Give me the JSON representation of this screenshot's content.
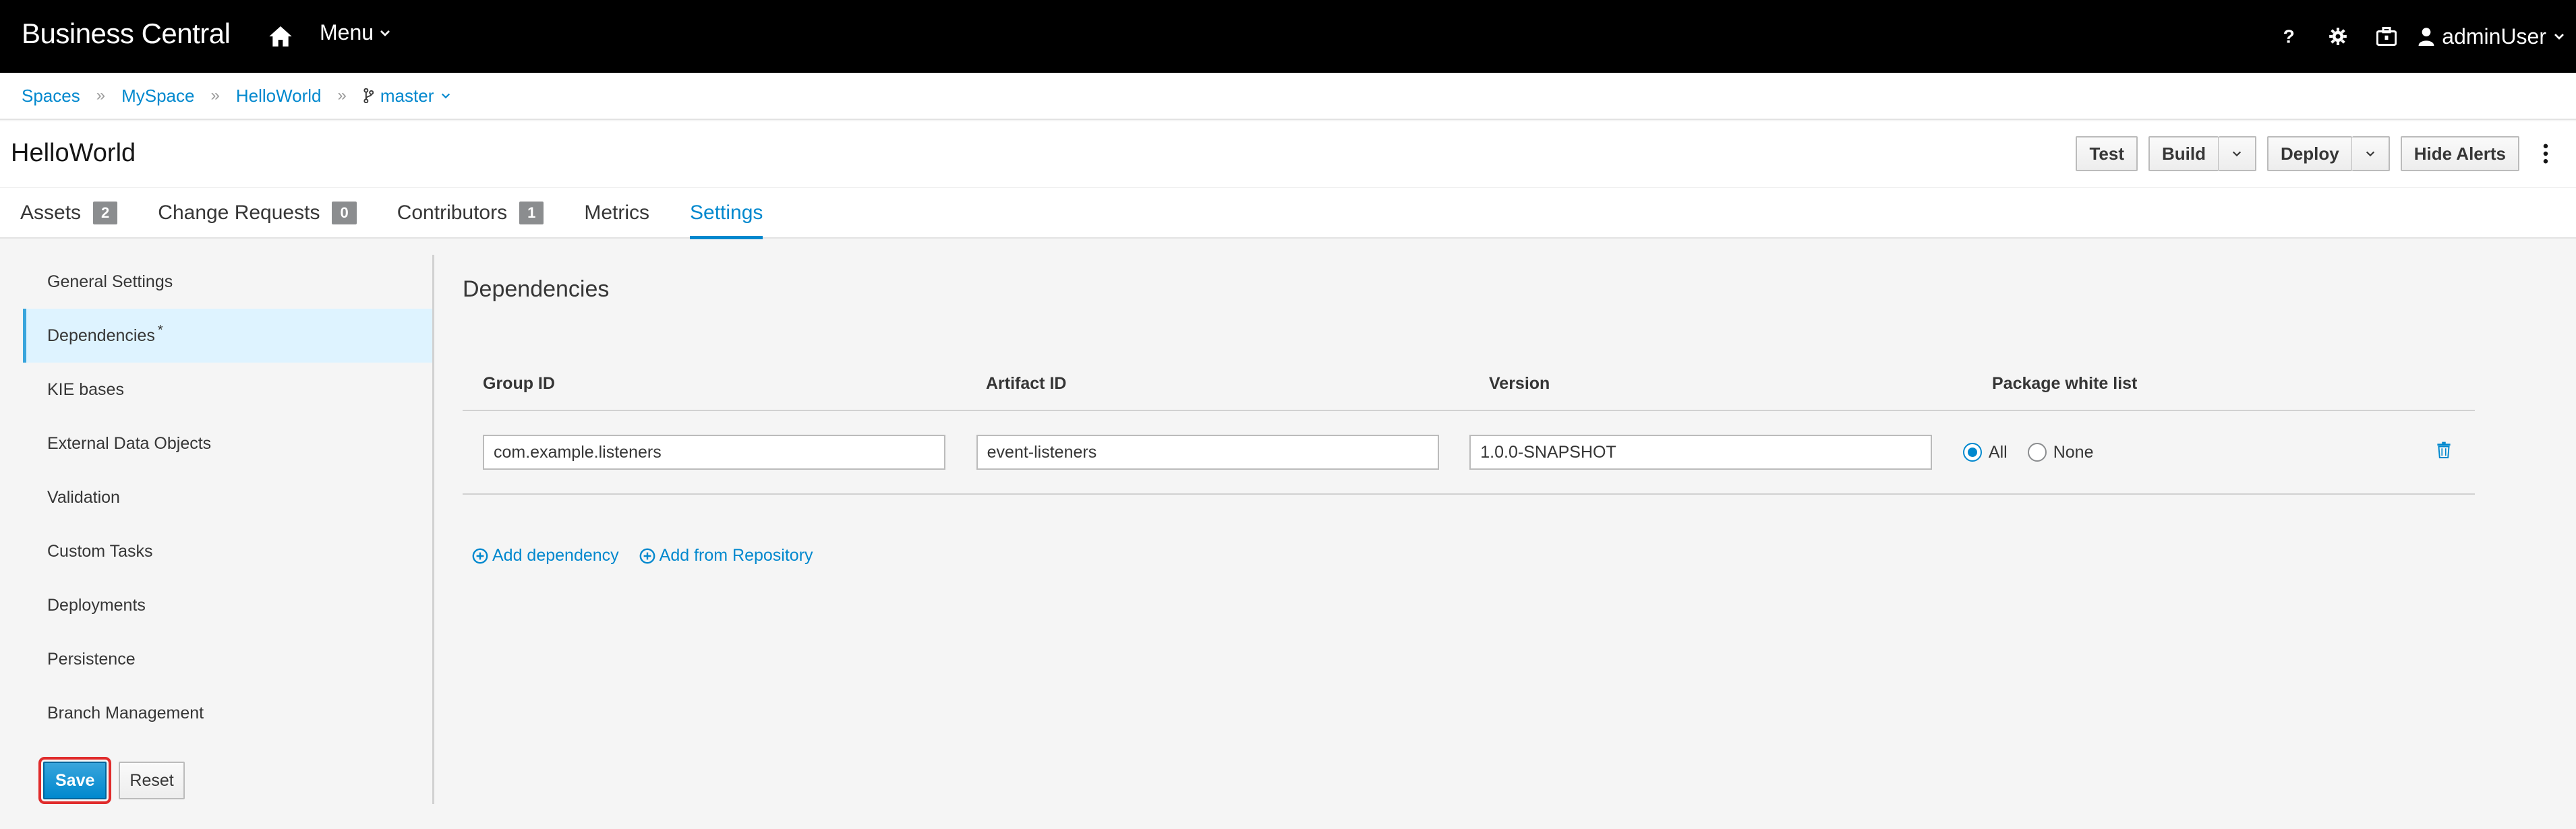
{
  "app": {
    "brand": "Business Central",
    "menu_label": "Menu",
    "user": "adminUser"
  },
  "breadcrumb": [
    "Spaces",
    "MySpace",
    "HelloWorld"
  ],
  "branch": "master",
  "page_title": "HelloWorld",
  "toolbar": {
    "test": "Test",
    "build": "Build",
    "deploy": "Deploy",
    "hide_alerts": "Hide Alerts"
  },
  "tabs": [
    {
      "label": "Assets",
      "badge": "2"
    },
    {
      "label": "Change Requests",
      "badge": "0"
    },
    {
      "label": "Contributors",
      "badge": "1"
    },
    {
      "label": "Metrics"
    },
    {
      "label": "Settings",
      "active": true
    }
  ],
  "nav": {
    "items": [
      "General Settings",
      "Dependencies",
      "KIE bases",
      "External Data Objects",
      "Validation",
      "Custom Tasks",
      "Deployments",
      "Persistence",
      "Branch Management"
    ],
    "modified_marker": "*",
    "save": "Save",
    "reset": "Reset"
  },
  "dependencies": {
    "title": "Dependencies",
    "columns": [
      "Group ID",
      "Artifact ID",
      "Version",
      "Package white list"
    ],
    "rows": [
      {
        "group_id": "com.example.listeners",
        "artifact_id": "event-listeners",
        "version": "1.0.0-SNAPSHOT",
        "whitelist_all": "All",
        "whitelist_none": "None",
        "selected": "All"
      }
    ],
    "add_dependency": "Add dependency",
    "add_from_repository": "Add from Repository"
  },
  "colors": {
    "accent": "#0088ce",
    "topbar": "#000000",
    "highlight": "#e02b2b"
  }
}
